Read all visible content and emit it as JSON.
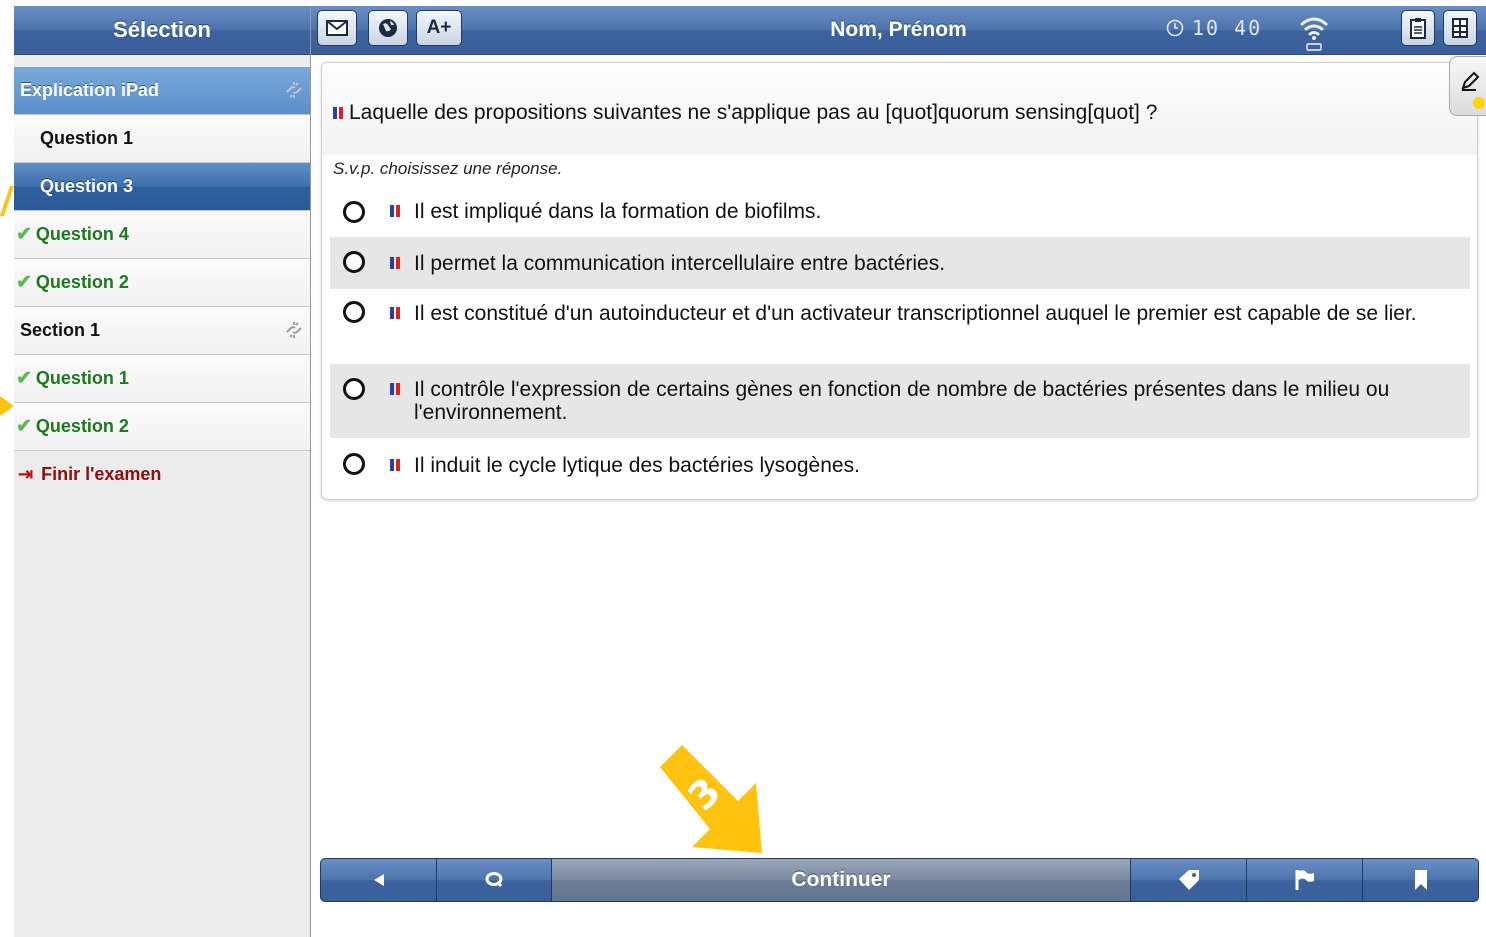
{
  "sidebar": {
    "header": "Sélection",
    "items": [
      {
        "label": "Explication iPad",
        "kind": "explain"
      },
      {
        "label": "Question 1",
        "kind": "question"
      },
      {
        "label": "Question 3",
        "kind": "selected"
      },
      {
        "label": "Question 4",
        "kind": "checked"
      },
      {
        "label": "Question 2",
        "kind": "checked"
      },
      {
        "label": "Section 1",
        "kind": "section"
      },
      {
        "label": "Question 1",
        "kind": "checked"
      },
      {
        "label": "Question 2",
        "kind": "checked"
      }
    ],
    "finish_label": "Finir l'examen"
  },
  "toolbar": {
    "title": "Nom, Prénom",
    "font_button_label": "A+",
    "clock": "10 40"
  },
  "question": {
    "text": "Laquelle des propositions suivantes ne s'applique pas au [quot]quorum sensing[quot] ?",
    "instruction": "S.v.p. choisissez une réponse.",
    "options": [
      "Il est impliqué dans la formation de biofilms.",
      "Il permet la communication intercellulaire entre bactéries.",
      "Il est constitué d'un autoinducteur et d'un activateur transcriptionnel auquel le premier est capable de se lier.",
      "Il contrôle l'expression de certains gènes en fonction de nombre de bactéries présentes dans le milieu ou l'environnement.",
      "Il induit le cycle lytique des bactéries lysogènes."
    ]
  },
  "bottombar": {
    "continue_label": "Continuer"
  },
  "overlay": {
    "step_number": "3",
    "accent_color": "#ffc20e"
  }
}
